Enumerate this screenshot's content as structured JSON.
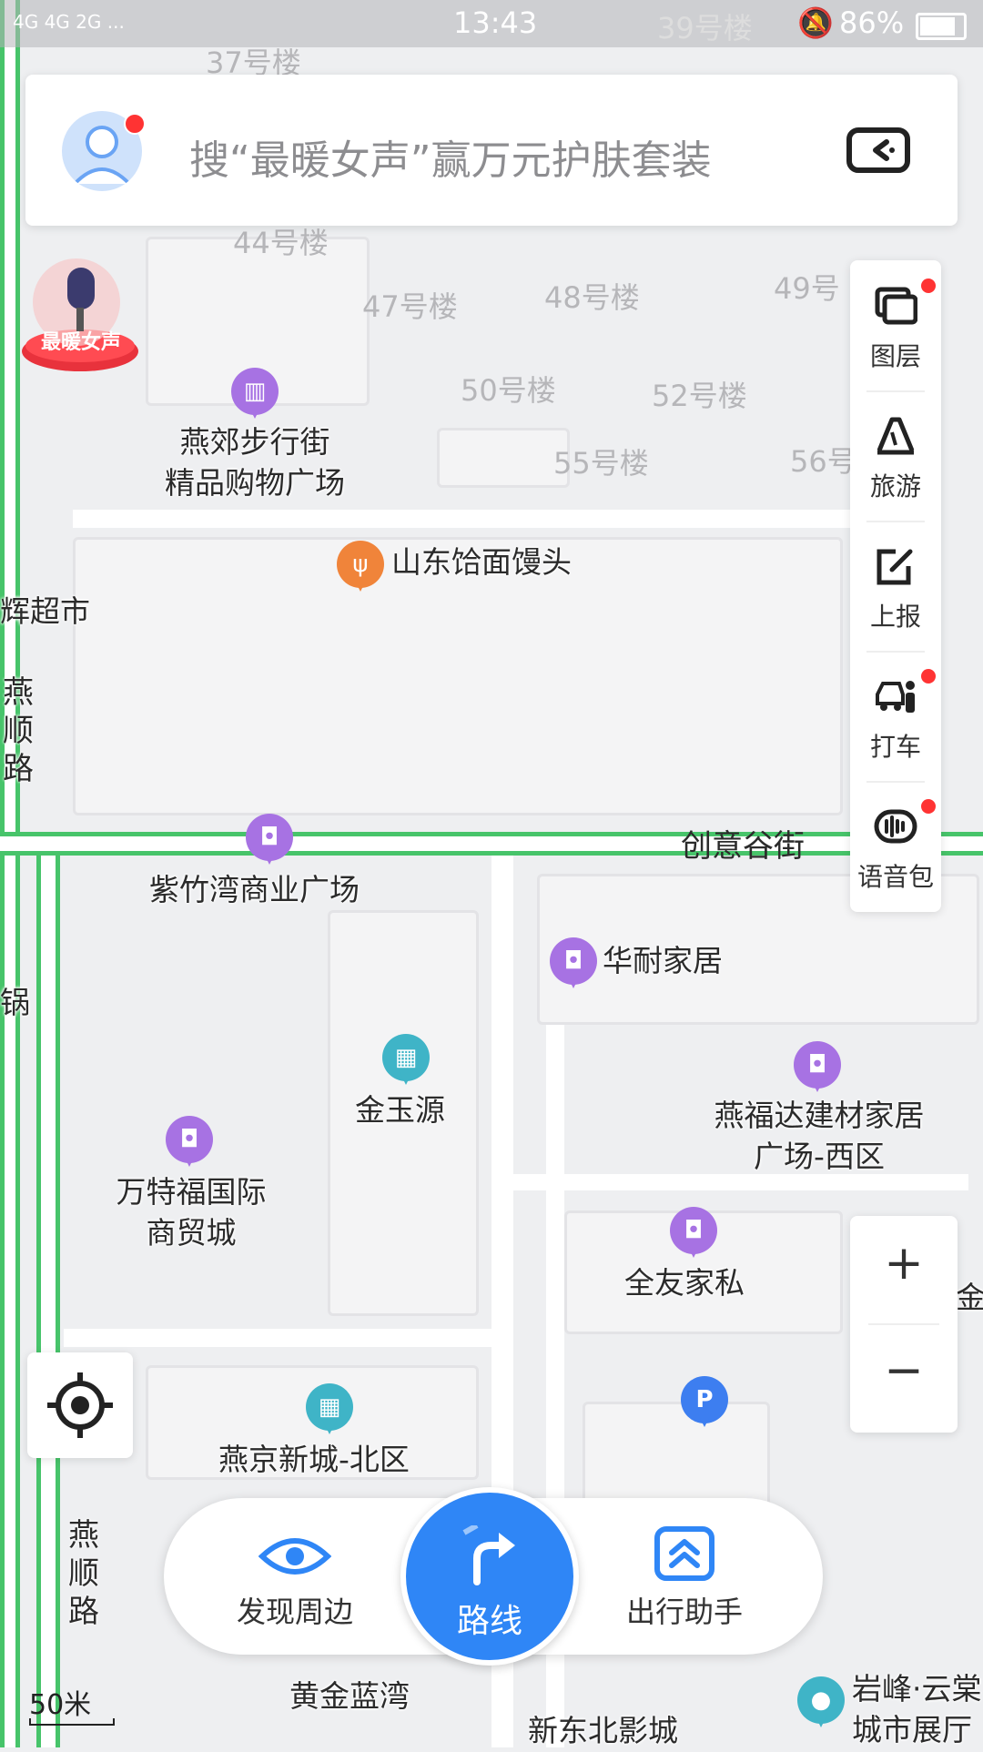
{
  "status_bar": {
    "signal_left": "4G 4G 2G ...",
    "time": "13:43",
    "top_label": "39号楼",
    "battery": "86%"
  },
  "search": {
    "placeholder": "搜“最暖女声”赢万元护肤套装"
  },
  "voice_badge": {
    "label": "最暖女声"
  },
  "tools": [
    {
      "label": "图层",
      "icon": "layers-icon",
      "badge": true
    },
    {
      "label": "旅游",
      "icon": "travel-icon",
      "badge": false
    },
    {
      "label": "上报",
      "icon": "report-icon",
      "badge": false
    },
    {
      "label": "打车",
      "icon": "taxi-icon",
      "badge": true
    },
    {
      "label": "语音包",
      "icon": "voice-pack-icon",
      "badge": true
    }
  ],
  "zoom": {
    "in": "+",
    "out": "−"
  },
  "bottom_nav": {
    "discover": "发现周边",
    "route": "路线",
    "assistant": "出行助手"
  },
  "scale": "50米",
  "map": {
    "buildings": [
      "37号楼",
      "44号楼",
      "47号楼",
      "48号楼",
      "49号",
      "50号楼",
      "52号楼",
      "55号楼",
      "56号"
    ],
    "pois": {
      "yanjiao_mall_1": "燕郊步行街",
      "yanjiao_mall_2": "精品购物广场",
      "shandong": "山东饸面馒头",
      "supermarket": "辉超市",
      "zizhuwan": "紫竹湾商业广场",
      "huanai": "华耐家居",
      "jinyuyuan": "金玉源",
      "yanfuda_1": "燕福达建材家居",
      "yanfuda_2": "广场-西区",
      "wantefu_1": "万特福国际",
      "wantefu_2": "商贸城",
      "quanyou": "全友家私",
      "yanjing": "燕京新城-北区",
      "huangjin": "黄金蓝湾",
      "xindongbei": "新东北影城",
      "yanfeng_1": "岩峰·云棠",
      "yanfeng_2": "城市展厅",
      "guo": "锅",
      "jin": "金"
    },
    "streets": {
      "chuangyi": "创意谷街",
      "yanshun_top": "燕顺路",
      "yanshun_bottom": "燕顺路"
    },
    "colors": {
      "poi_purple": "#a772e3",
      "poi_orange": "#f0843a",
      "poi_teal": "#3fb4c7",
      "route_blue": "#2f86f6",
      "road_green": "#47c46a"
    }
  }
}
